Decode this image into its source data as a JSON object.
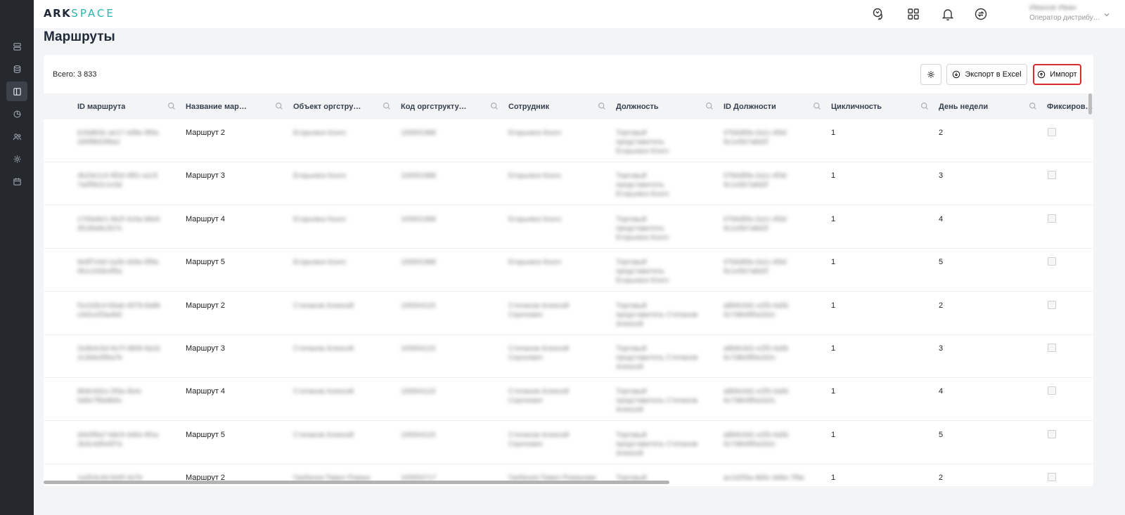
{
  "header": {
    "logo_bold": "ARK",
    "logo_light": "SPACE",
    "user_name": "Иванов Иван",
    "user_role": "Оператор дистрибу…",
    "icons": [
      "chat-icon",
      "apps-grid-icon",
      "bell-icon",
      "sync-icon"
    ]
  },
  "sidebar": {
    "items": [
      {
        "icon": "server-list-icon",
        "active": false
      },
      {
        "icon": "database-icon",
        "active": false
      },
      {
        "icon": "layout-panel-icon",
        "active": true
      },
      {
        "icon": "pie-chart-icon",
        "active": false
      },
      {
        "icon": "users-icon",
        "active": false
      },
      {
        "icon": "gear-icon",
        "active": false
      },
      {
        "icon": "calendar-icon",
        "active": false
      }
    ]
  },
  "page": {
    "title": "Маршруты"
  },
  "toolbar": {
    "total": "Всего: 3 833",
    "export_label": "Экспорт в Excel",
    "import_label": "Импорт"
  },
  "table": {
    "columns": [
      "ID маршрута",
      "Название маршр…",
      "Объект оргструкт…",
      "Код оргструктур…",
      "Сотрудник",
      "Должность",
      "ID Должности",
      "Цикличность",
      "День недели",
      "Фиксирован"
    ],
    "rows": [
      {
        "id": [
          "b1fa8b3c-ae17-4d9e-9f0a",
          "2d0f8b53f6a1"
        ],
        "name": "Маршрут 2",
        "org": [
          "Егорьевск Конго"
        ],
        "code": [
          "100001988"
        ],
        "emp": [
          "Егорьевск Конго"
        ],
        "pos": [
          "Торговый",
          "представитель",
          "Егорьевск Конго"
        ],
        "pos_id": [
          "07b6d5fa-2a1c-4f3d",
          "9c1e5b7a8d2f"
        ],
        "cycle": "1",
        "day": "2"
      },
      {
        "id": [
          "4b23e1c0-9f2d-4f81-a1c5",
          "7a0f5b2c1e3d"
        ],
        "name": "Маршрут 3",
        "org": [
          "Егорьевск Конго"
        ],
        "code": [
          "100001988"
        ],
        "emp": [
          "Егорьевск Конго"
        ],
        "pos": [
          "Торговый",
          "представитель",
          "Егорьевск Конго"
        ],
        "pos_id": [
          "07b6d5fa-2a1c-4f3d",
          "9c1e5b7a8d2f"
        ],
        "cycle": "1",
        "day": "3"
      },
      {
        "id": [
          "c7d3a9e1-5b2f-4c0a-b8e6",
          "3f1d0a9c2b7e"
        ],
        "name": "Маршрут 4",
        "org": [
          "Егорьевск Конго"
        ],
        "code": [
          "100001988"
        ],
        "emp": [
          "Егорьевск Конго"
        ],
        "pos": [
          "Торговый",
          "представитель",
          "Егорьевск Конго"
        ],
        "pos_id": [
          "07b6d5fa-2a1c-4f3d",
          "9c1e5b7a8d2f"
        ],
        "cycle": "1",
        "day": "4"
      },
      {
        "id": [
          "9e8f7c6d-1a2b-4d3e-8f9a",
          "0b1c2d3e4f5a"
        ],
        "name": "Маршрут 5",
        "org": [
          "Егорьевск Конго"
        ],
        "code": [
          "100001988"
        ],
        "emp": [
          "Егорьевск Конго"
        ],
        "pos": [
          "Торговый",
          "представитель",
          "Егорьевск Конго"
        ],
        "pos_id": [
          "07b6d5fa-2a1c-4f3d",
          "9c1e5b7a8d2f"
        ],
        "cycle": "1",
        "day": "5"
      },
      {
        "id": [
          "f1e2d3c4-b5a6-4978-8a9b",
          "c0d1e2f3a4b5"
        ],
        "name": "Маршрут 2",
        "org": [
          "Степанов Алексей"
        ],
        "code": [
          "100004115"
        ],
        "emp": [
          "Степанов Алексей",
          "Сергеевич"
        ],
        "pos": [
          "Торговый",
          "представитель Степанов",
          "Алексей"
        ],
        "pos_id": [
          "a8b9c0d1-e2f3-4a5b",
          "6c7d8e9f0a1b2c"
        ],
        "cycle": "1",
        "day": "2"
      },
      {
        "id": [
          "2a3b4c5d-6e7f-4809-9a1b",
          "2c3d4e5f6a7b"
        ],
        "name": "Маршрут 3",
        "org": [
          "Степанов Алексей"
        ],
        "code": [
          "100004115"
        ],
        "emp": [
          "Степанов Алексей",
          "Сергеевич"
        ],
        "pos": [
          "Торговый",
          "представитель Степанов",
          "Алексей"
        ],
        "pos_id": [
          "a8b9c0d1-e2f3-4a5b",
          "6c7d8e9f0a1b2c"
        ],
        "cycle": "1",
        "day": "3"
      },
      {
        "id": [
          "8b9c0d1e-2f3a-4b4c",
          "5d6e7f8a9b0c"
        ],
        "name": "Маршрут 4",
        "org": [
          "Степанов Алексей"
        ],
        "code": [
          "100004115"
        ],
        "emp": [
          "Степанов Алексей",
          "Сергеевич"
        ],
        "pos": [
          "Торговый",
          "представитель Степанов",
          "Алексей"
        ],
        "pos_id": [
          "a8b9c0d1-e2f3-4a5b",
          "6c7d8e9f0a1b2c"
        ],
        "cycle": "1",
        "day": "4"
      },
      {
        "id": [
          "d4e5f6a7-b8c9-4d0e-9f1a",
          "2b3c4d5e6f7a"
        ],
        "name": "Маршрут 5",
        "org": [
          "Степанов Алексей"
        ],
        "code": [
          "100004115"
        ],
        "emp": [
          "Степанов Алексей",
          "Сергеевич"
        ],
        "pos": [
          "Торговый",
          "представитель Степанов",
          "Алексей"
        ],
        "pos_id": [
          "a8b9c0d1-e2f3-4a5b",
          "6c7d8e9f0a1b2c"
        ],
        "cycle": "1",
        "day": "5"
      },
      {
        "id": [
          "1a2b3c4d-5e6f-4a7b"
        ],
        "name": "Маршрут 2",
        "org": [
          "Грибачев Павел Романович"
        ],
        "code": [
          "100003717"
        ],
        "emp": [
          "Грибачев Павел Романович"
        ],
        "pos": [
          "Торговый"
        ],
        "pos_id": [
          "ac1d2f3a-4b5c-4d6e-7f8a"
        ],
        "cycle": "1",
        "day": "2"
      }
    ]
  }
}
